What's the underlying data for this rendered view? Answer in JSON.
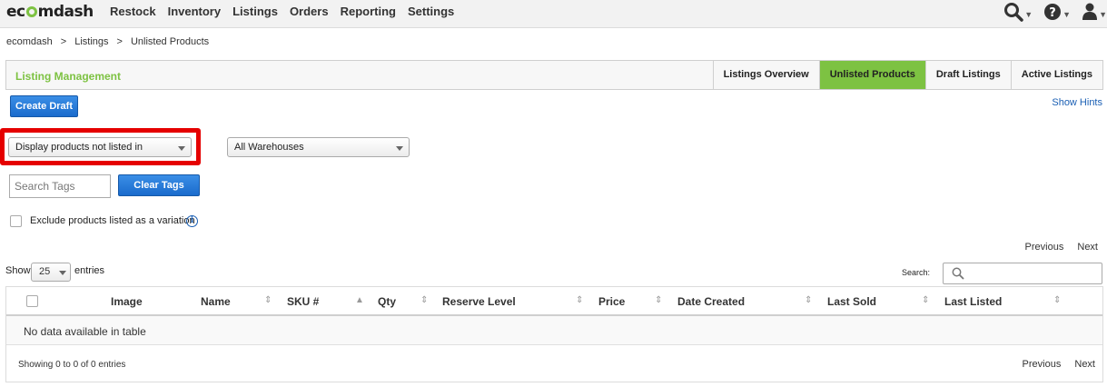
{
  "nav": {
    "logo_pre": "ec",
    "logo_post": "mdash",
    "items": [
      "Restock",
      "Inventory",
      "Listings",
      "Orders",
      "Reporting",
      "Settings"
    ],
    "icons": [
      "search-icon",
      "help-icon",
      "user-icon"
    ]
  },
  "breadcrumb": [
    "ecomdash",
    ">",
    "Listings",
    ">",
    "Unlisted Products"
  ],
  "panel": {
    "title": "Listing Management",
    "tabs": [
      {
        "label": "Listings Overview",
        "active": false
      },
      {
        "label": "Unlisted Products",
        "active": true
      },
      {
        "label": "Draft Listings",
        "active": false
      },
      {
        "label": "Active Listings",
        "active": false
      }
    ]
  },
  "actions": {
    "create_draft": "Create Draft",
    "show_hints": "Show Hints",
    "clear_tags": "Clear Tags"
  },
  "filters": {
    "display_select": "Display products not listed in",
    "warehouse_select": "All Warehouses",
    "tag_placeholder": "Search Tags",
    "exclude_label": "Exclude products listed as a variation",
    "info_glyph": "i"
  },
  "pagination": {
    "previous": "Previous",
    "next": "Next"
  },
  "entries": {
    "show_label": "Show",
    "value": "25",
    "suffix": "entries",
    "search_label": "Search:"
  },
  "table": {
    "columns": [
      "Image",
      "Name",
      "SKU #",
      "Qty",
      "Reserve Level",
      "Price",
      "Date Created",
      "Last Sold",
      "Last Listed"
    ],
    "empty_message": "No data available in table",
    "info": "Showing 0 to 0 of 0 entries"
  },
  "colors": {
    "accent_green": "#7dc242",
    "button_blue": "#1a6bcc",
    "highlight_red": "#e50000"
  }
}
